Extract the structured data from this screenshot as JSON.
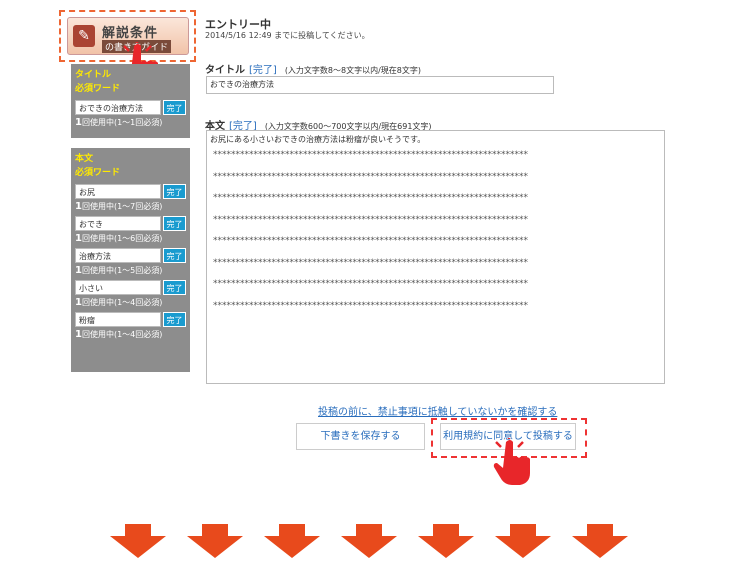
{
  "guide": {
    "title": "解説条件",
    "subtitle": "の書き方ガイド",
    "icon": "brush-icon"
  },
  "sidebar": {
    "title_panel": {
      "heading": "タイトル",
      "subheading": "必須ワード",
      "words": [
        {
          "word": "おできの治療方法",
          "done": "完了",
          "used": "1",
          "usage": "回使用中(1～1回必須)"
        }
      ]
    },
    "body_panel": {
      "heading": "本文",
      "subheading": "必須ワード",
      "words": [
        {
          "word": "お尻",
          "done": "完了",
          "used": "1",
          "usage": "回使用中(1～7回必須)"
        },
        {
          "word": "おでき",
          "done": "完了",
          "used": "1",
          "usage": "回使用中(1～6回必須)"
        },
        {
          "word": "治療方法",
          "done": "完了",
          "used": "1",
          "usage": "回使用中(1～5回必須)"
        },
        {
          "word": "小さい",
          "done": "完了",
          "used": "1",
          "usage": "回使用中(1～4回必須)"
        },
        {
          "word": "粉瘤",
          "done": "完了",
          "used": "1",
          "usage": "回使用中(1～4回必須)"
        }
      ]
    }
  },
  "entry": {
    "status": "エントリー中",
    "deadline": "2014/5/16 12:49 までに投稿してください。"
  },
  "title_field": {
    "label": "タイトル",
    "status": "[完了]",
    "note": "(入力文字数8～8文字以内/現在8文字)",
    "value": "おできの治療方法"
  },
  "body_field": {
    "label": "本文",
    "status": "[完了]",
    "note": "(入力文字数600～700文字以内/現在691文字)",
    "first_line": "お尻にある小さいおできの治療方法は粉瘤が良いそうです。",
    "masked_lines": [
      "**********************************************************************",
      "**********************************************************************",
      "**********************************************************************",
      "**********************************************************************",
      "**********************************************************************",
      "**********************************************************************",
      "**********************************************************************",
      "**********************************************************************"
    ]
  },
  "actions": {
    "confirm_link": "投稿の前に、禁止事項に抵触していないかを確認する",
    "draft": "下書きを保存する",
    "submit": "利用規約に同意して投稿する"
  },
  "colors": {
    "accent_red": "#e84a1c",
    "link_blue": "#2a6ebd",
    "done_blue": "#1a9bcf",
    "panel_gray": "#8d8d8d",
    "panel_yellow": "#ffea00"
  },
  "decorations": {
    "pointer": "pointing-hand-icon",
    "arrow": "down-arrow-icon",
    "arrow_count": 7
  }
}
